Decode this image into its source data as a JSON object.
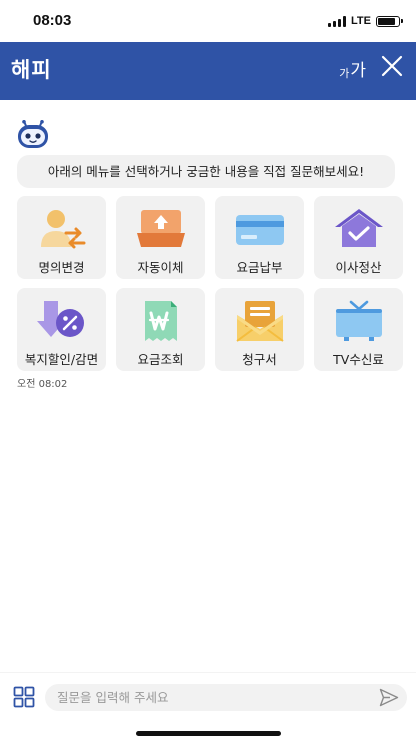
{
  "status_bar": {
    "time": "08:03",
    "network": "LTE",
    "battery_level": 0.85
  },
  "header": {
    "title": "해피",
    "font_size_small": "가",
    "font_size_large": "가"
  },
  "chat": {
    "bot_message": "아래의 메뉴를 선택하거나 궁금한 내용을 직접 질문해보세요!",
    "time": "오전 08:02"
  },
  "menu": [
    {
      "label": "명의변경",
      "icon": "name-change-icon"
    },
    {
      "label": "자동이체",
      "icon": "auto-transfer-icon"
    },
    {
      "label": "요금납부",
      "icon": "payment-card-icon"
    },
    {
      "label": "이사정산",
      "icon": "moving-house-icon"
    },
    {
      "label": "복지할인/감면",
      "icon": "welfare-discount-icon"
    },
    {
      "label": "요금조회",
      "icon": "bill-inquiry-icon"
    },
    {
      "label": "청구서",
      "icon": "invoice-envelope-icon"
    },
    {
      "label": "TV수신료",
      "icon": "tv-fee-icon"
    }
  ],
  "input": {
    "placeholder": "질문을 입력해 주세요"
  },
  "colors": {
    "header": "#2F53A6",
    "bubble": "#F1F1F1"
  }
}
